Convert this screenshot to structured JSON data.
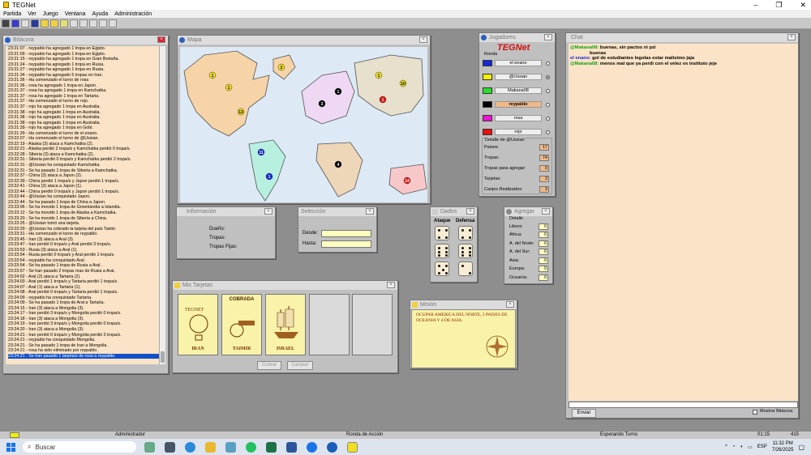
{
  "app": {
    "title": "TEGNet",
    "window_controls": [
      "–",
      "❐",
      "✕"
    ]
  },
  "menu": [
    "Partida",
    "Ver",
    "Juego",
    "Ventana",
    "Ayuda",
    "Administración"
  ],
  "bitacora": {
    "title": "Bitácora",
    "lines": [
      "23:21:07 - reypablo ha agregado 1 tropa en Egipto.",
      "23:21:09 - reypablo ha agregado 1 tropa en Egipto.",
      "23:21:15 - reypablo ha agregado 1 tropa en Gran Bretaña.",
      "23:21:24 - reypablo ha agregado 1 tropa en Rusia.",
      "23:21:27 - reypablo ha agregado 1 tropa en Rusia.",
      "23:21:34 - reypablo ha agregado 5 tropas en Iran.",
      "23:21:36 - Ha comenzado el turno de rosa",
      "23:21:36 - rosa ha agregado 1 tropa en Japon.",
      "23:21:37 - rosa ha agregado 1 tropa en Kamchatka.",
      "23:21:37 - rosa ha agregado 1 tropa en Tartaria.",
      "23:21:37 - Ha comenzado el turno de rojo.",
      "23:21:37 - rojo ha agregado 1 tropa en Australia.",
      "23:21:38 - rojo ha agregado 1 tropa en Australia.",
      "23:21:38 - rojo ha agregado 1 tropa en Australia.",
      "23:21:38 - rojo ha agregado 1 tropa en Australia.",
      "23:21:39 - rojo ha agregado 1 tropa en Gobi.",
      "23:21:39 - Ha comenzado el turno de el enano.",
      "23:22:07 - Ha comenzado el turno de @Ussian.",
      "23:22:19 - Alaska (3) ataca a Kamchatka (2).",
      "23:22:21 - Alaska perdió 2 tropa/s y Kamchatka perdió 0 tropa/s.",
      "23:22:28 - Siberia (3) ataca a Kamchatka (2).",
      "23:22:31 - Siberia perdió 0 tropa/s y Kamchatka perdió 2 tropa/s.",
      "23:22:31 - @Ussian ha conquistado Kamchatka.",
      "23:22:31 - Se ha pasado 1 tropa de Siberia a Kamchatka.",
      "23:22:37 - China (3) ataca a Japon (2).",
      "23:22:39 - China perdió 1 tropa/s y Japon perdió 1 tropa/s.",
      "23:22:41 - China (3) ataca a Japon (1).",
      "23:22:44 - China perdió 0 tropa/s y Japon perdió 1 tropa/s.",
      "23:22:44 - @Ussian ha conquistado Japon.",
      "23:22:44 - Se ha pasado 1 tropa de China a Japon.",
      "23:23:06 - Se ha movido 1 tropa de Groenlandia a Islandia.",
      "23:23:12 - Se ha movido 1 tropa de Alaska a Kamchatka.",
      "23:23:20 - Se ha movido 1 tropa de Siberia a China.",
      "23:23:25 - @Ussian tomó una tarjeta.",
      "23:23:29 - @Ussian ha cobrado la tarjeta del país Taimir.",
      "23:23:31 - Ha comenzado el turno de reypablo.",
      "23:23:45 - Iran (3) ataca a Aral (3).",
      "23:23:47 - Iran perdió 0 tropa/s y Aral perdió 3 tropa/s.",
      "23:23:53 - Rusia (3) ataca a Aral (1).",
      "23:23:54 - Rusia perdió 0 tropa/s y Aral perdió 1 tropa/s.",
      "23:23:54 - reypablo ha conquistado Aral.",
      "23:23:54 - Se ha pasado 1 tropa de Rusia a Aral.",
      "23:23:57 - Se han pasado 2 tropas mas de Rusia a Aral.",
      "23:24:02 - Aral (2) ataca a Tartaria (2).",
      "23:24:03 - Aral perdió 1 tropa/s y Tartaria perdió 1 tropa/s.",
      "23:24:07 - Aral (1) ataca a Tartaria (1).",
      "23:24:08 - Aral perdió 0 tropa/s y Tartaria perdió 1 tropa/s.",
      "23:24:09 - reypablo ha conquistado Tartaria.",
      "23:24:09 - Se ha pasado 1 tropa de Aral a Tartaria.",
      "23:24:15 - Iran (3) ataca a Mongolia (3).",
      "23:24:17 - Iran perdió 3 tropa/s y Mongolia perdió 0 tropa/s.",
      "23:24:18 - Iran (3) ataca a Mongolia (3).",
      "23:24:19 - Iran perdió 3 tropa/s y Mongolia perdió 0 tropa/s.",
      "23:24:20 - Iran (3) ataca a Mongolia (3).",
      "23:24:21 - Iran perdió 0 tropa/s y Mongolia perdió 3 tropa/s.",
      "23:24:21 - reypablo ha conquistado Mongolia.",
      "23:24:21 - Se ha pasado 1 tropa de Iran a Mongolia.",
      "23:24:21 - rosa ha sido eliminado por reypablo.",
      "23:24:21 - Se han pasado 1 tarjeta/s de rosa a reypablo."
    ]
  },
  "mapa": {
    "title": "Mapa"
  },
  "informacion": {
    "title": "Información",
    "dueno": "Dueño:",
    "tropas": "Tropas:",
    "tropas_fijas": "Tropas Fijas:"
  },
  "seleccion": {
    "title": "Selección",
    "desde": "Desde:",
    "hasta": "Hasta:"
  },
  "tarjetas": {
    "title": "Mis Tarjetas",
    "cards": [
      "IRAN",
      "TAIMIR",
      "ISRAEL"
    ],
    "cobrada": "COBRADA",
    "tegnet_card": "TEGNET",
    "cobrar": "Cobrar",
    "canjear": "Canjear"
  },
  "dados": {
    "title": "Dados",
    "ataque": "Ataque",
    "defensa": "Defensa",
    "attack": [
      4,
      6,
      5
    ],
    "defense": [
      4,
      6,
      2
    ]
  },
  "mision": {
    "title": "Misión",
    "text": "OCUPAR AMERICA DEL NORTE, 2 PAISES DE OCEANIA Y 4 DE ASIA."
  },
  "jugadores": {
    "title": "Jugadores",
    "logo": "TEGNet",
    "ronda": "Ronda",
    "players": [
      {
        "name": "el enano",
        "color": "#1428d8",
        "selected": false,
        "bold": false
      },
      {
        "name": "@Ussian",
        "color": "#f8f000",
        "selected": true,
        "bold": false
      },
      {
        "name": "Makana08",
        "color": "#28e028",
        "selected": false,
        "bold": false
      },
      {
        "name": "reypablo",
        "color": "#000000",
        "selected": false,
        "bold": true
      },
      {
        "name": "rosa",
        "color": "#f010d8",
        "selected": false,
        "bold": false
      },
      {
        "name": "rojo",
        "color": "#e81010",
        "selected": false,
        "bold": false
      }
    ],
    "detalle_title": "Detalle de @Ussian",
    "detalle": [
      {
        "label": "Paises:",
        "value": "17"
      },
      {
        "label": "Tropas:",
        "value": "74"
      },
      {
        "label": "Tropas para agregar:",
        "value": "0"
      },
      {
        "label": "Tarjetas:",
        "value": "3"
      },
      {
        "label": "Canjes Realizados:",
        "value": "3"
      }
    ]
  },
  "agregar": {
    "title": "Agregar",
    "detalle": "Detalle",
    "rows": [
      {
        "label": "Libres:",
        "value": "0"
      },
      {
        "label": "África:",
        "value": "0"
      },
      {
        "label": "A. del Norte:",
        "value": "0"
      },
      {
        "label": "A. del Sur:",
        "value": "0"
      },
      {
        "label": "Asia:",
        "value": "0"
      },
      {
        "label": "Europa:",
        "value": "0"
      },
      {
        "label": "Oceanía:",
        "value": "0"
      }
    ]
  },
  "chat": {
    "title": "Chat",
    "messages": [
      {
        "who": "@Makana08:",
        "text": "buenas, sin pactos ni pzi",
        "cls": "g"
      },
      {
        "who": "",
        "text": "buenas",
        "cls": ""
      },
      {
        "who": "el enano:",
        "text": "gol de estudiantes legolas estar malisimo jaja",
        "cls": "b"
      },
      {
        "who": "@Makana08:",
        "text": "menos mal que ya perdi con el velez vs instituto jeje",
        "cls": "g"
      }
    ],
    "enviar": "Enviar",
    "mostrar": "Mostrar Bitácora"
  },
  "status": {
    "user": "Administrador",
    "ronda": "Ronda de Acción",
    "turno": "Esperando Turno",
    "time": "01:15",
    "num": "415"
  },
  "taskbar": {
    "search": "Buscar",
    "lang": "ESP",
    "time": "11:32 PM",
    "date": "7/26/2025"
  },
  "colors": {
    "panel": "#c0c0c0",
    "log_bg": "#fae3c6",
    "field": "#ffffc0",
    "sel": "#1250c8"
  }
}
